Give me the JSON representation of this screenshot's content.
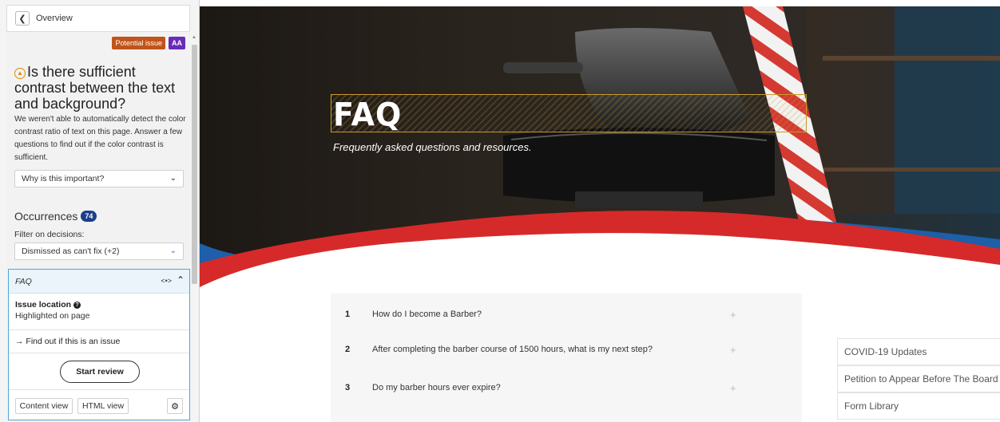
{
  "panel": {
    "back_label": "Overview",
    "badge_potential": "Potential issue",
    "badge_level": "AA",
    "question": "Is there sufficient contrast between the text and background?",
    "description": "We weren't able to automatically detect the color contrast ratio of text on this page. Answer a few questions to find out if the color contrast is sufficient.",
    "why_label": "Why is this important?",
    "occurrences_label": "Occurrences",
    "occurrences_count": "74",
    "filter_label": "Filter on decisions:",
    "filter_value": "Dismissed as can't fix (+2)",
    "occurrence": {
      "name": "FAQ",
      "issue_location_label": "Issue location",
      "issue_location_value": "Highlighted on page",
      "find_out_label": "Find out if this is an issue",
      "start_review_label": "Start review",
      "content_view_label": "Content view",
      "html_view_label": "HTML view"
    }
  },
  "hero": {
    "title": "FAQ",
    "subtitle": "Frequently asked questions and resources."
  },
  "faq": {
    "items": [
      {
        "num": "1",
        "question": "How do I become a Barber?"
      },
      {
        "num": "2",
        "question": "After completing the barber course of 1500 hours, what is my next step?"
      },
      {
        "num": "3",
        "question": "Do my barber hours ever expire?"
      }
    ]
  },
  "sidebar_links": [
    "COVID-19 Updates",
    "Petition to Appear Before The Board",
    "Form Library"
  ],
  "colors": {
    "badge_potential": "#c0541a",
    "badge_level": "#6a2bb8",
    "count_badge": "#1b3f8c",
    "card_border": "#4aa9d6",
    "hero_red": "#d62a2a",
    "hero_blue": "#1d5fa8"
  }
}
